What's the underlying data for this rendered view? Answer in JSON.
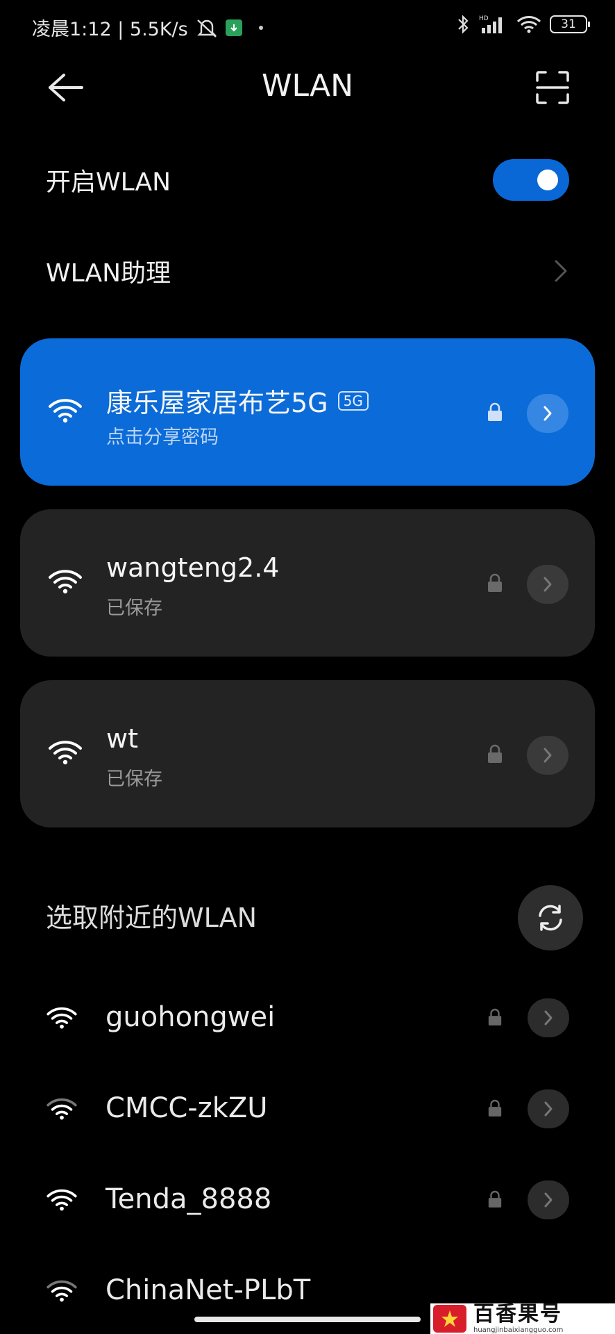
{
  "status_bar": {
    "time_text": "凌晨1:12 | 5.5K/s",
    "battery": "31"
  },
  "header": {
    "title": "WLAN"
  },
  "settings": {
    "enable_label": "开启WLAN",
    "enable_on": true,
    "assistant_label": "WLAN助理"
  },
  "saved_networks": [
    {
      "name": "康乐屋家居布艺5G",
      "badge": "5G",
      "status": "点击分享密码",
      "connected": true
    },
    {
      "name": "wangteng2.4",
      "badge": "",
      "status": "已保存",
      "connected": false
    },
    {
      "name": "wt",
      "badge": "",
      "status": "已保存",
      "connected": false
    }
  ],
  "nearby": {
    "heading": "选取附近的WLAN",
    "networks": [
      {
        "name": "guohongwei"
      },
      {
        "name": "CMCC-zkZU"
      },
      {
        "name": "Tenda_8888"
      },
      {
        "name": "ChinaNet-PLbT"
      }
    ]
  },
  "watermark": {
    "name": "百香果号",
    "url": "huangjinbaixiangguo.com"
  },
  "colors": {
    "accent": "#0b6bd8",
    "card": "#232323",
    "background": "#000000"
  }
}
